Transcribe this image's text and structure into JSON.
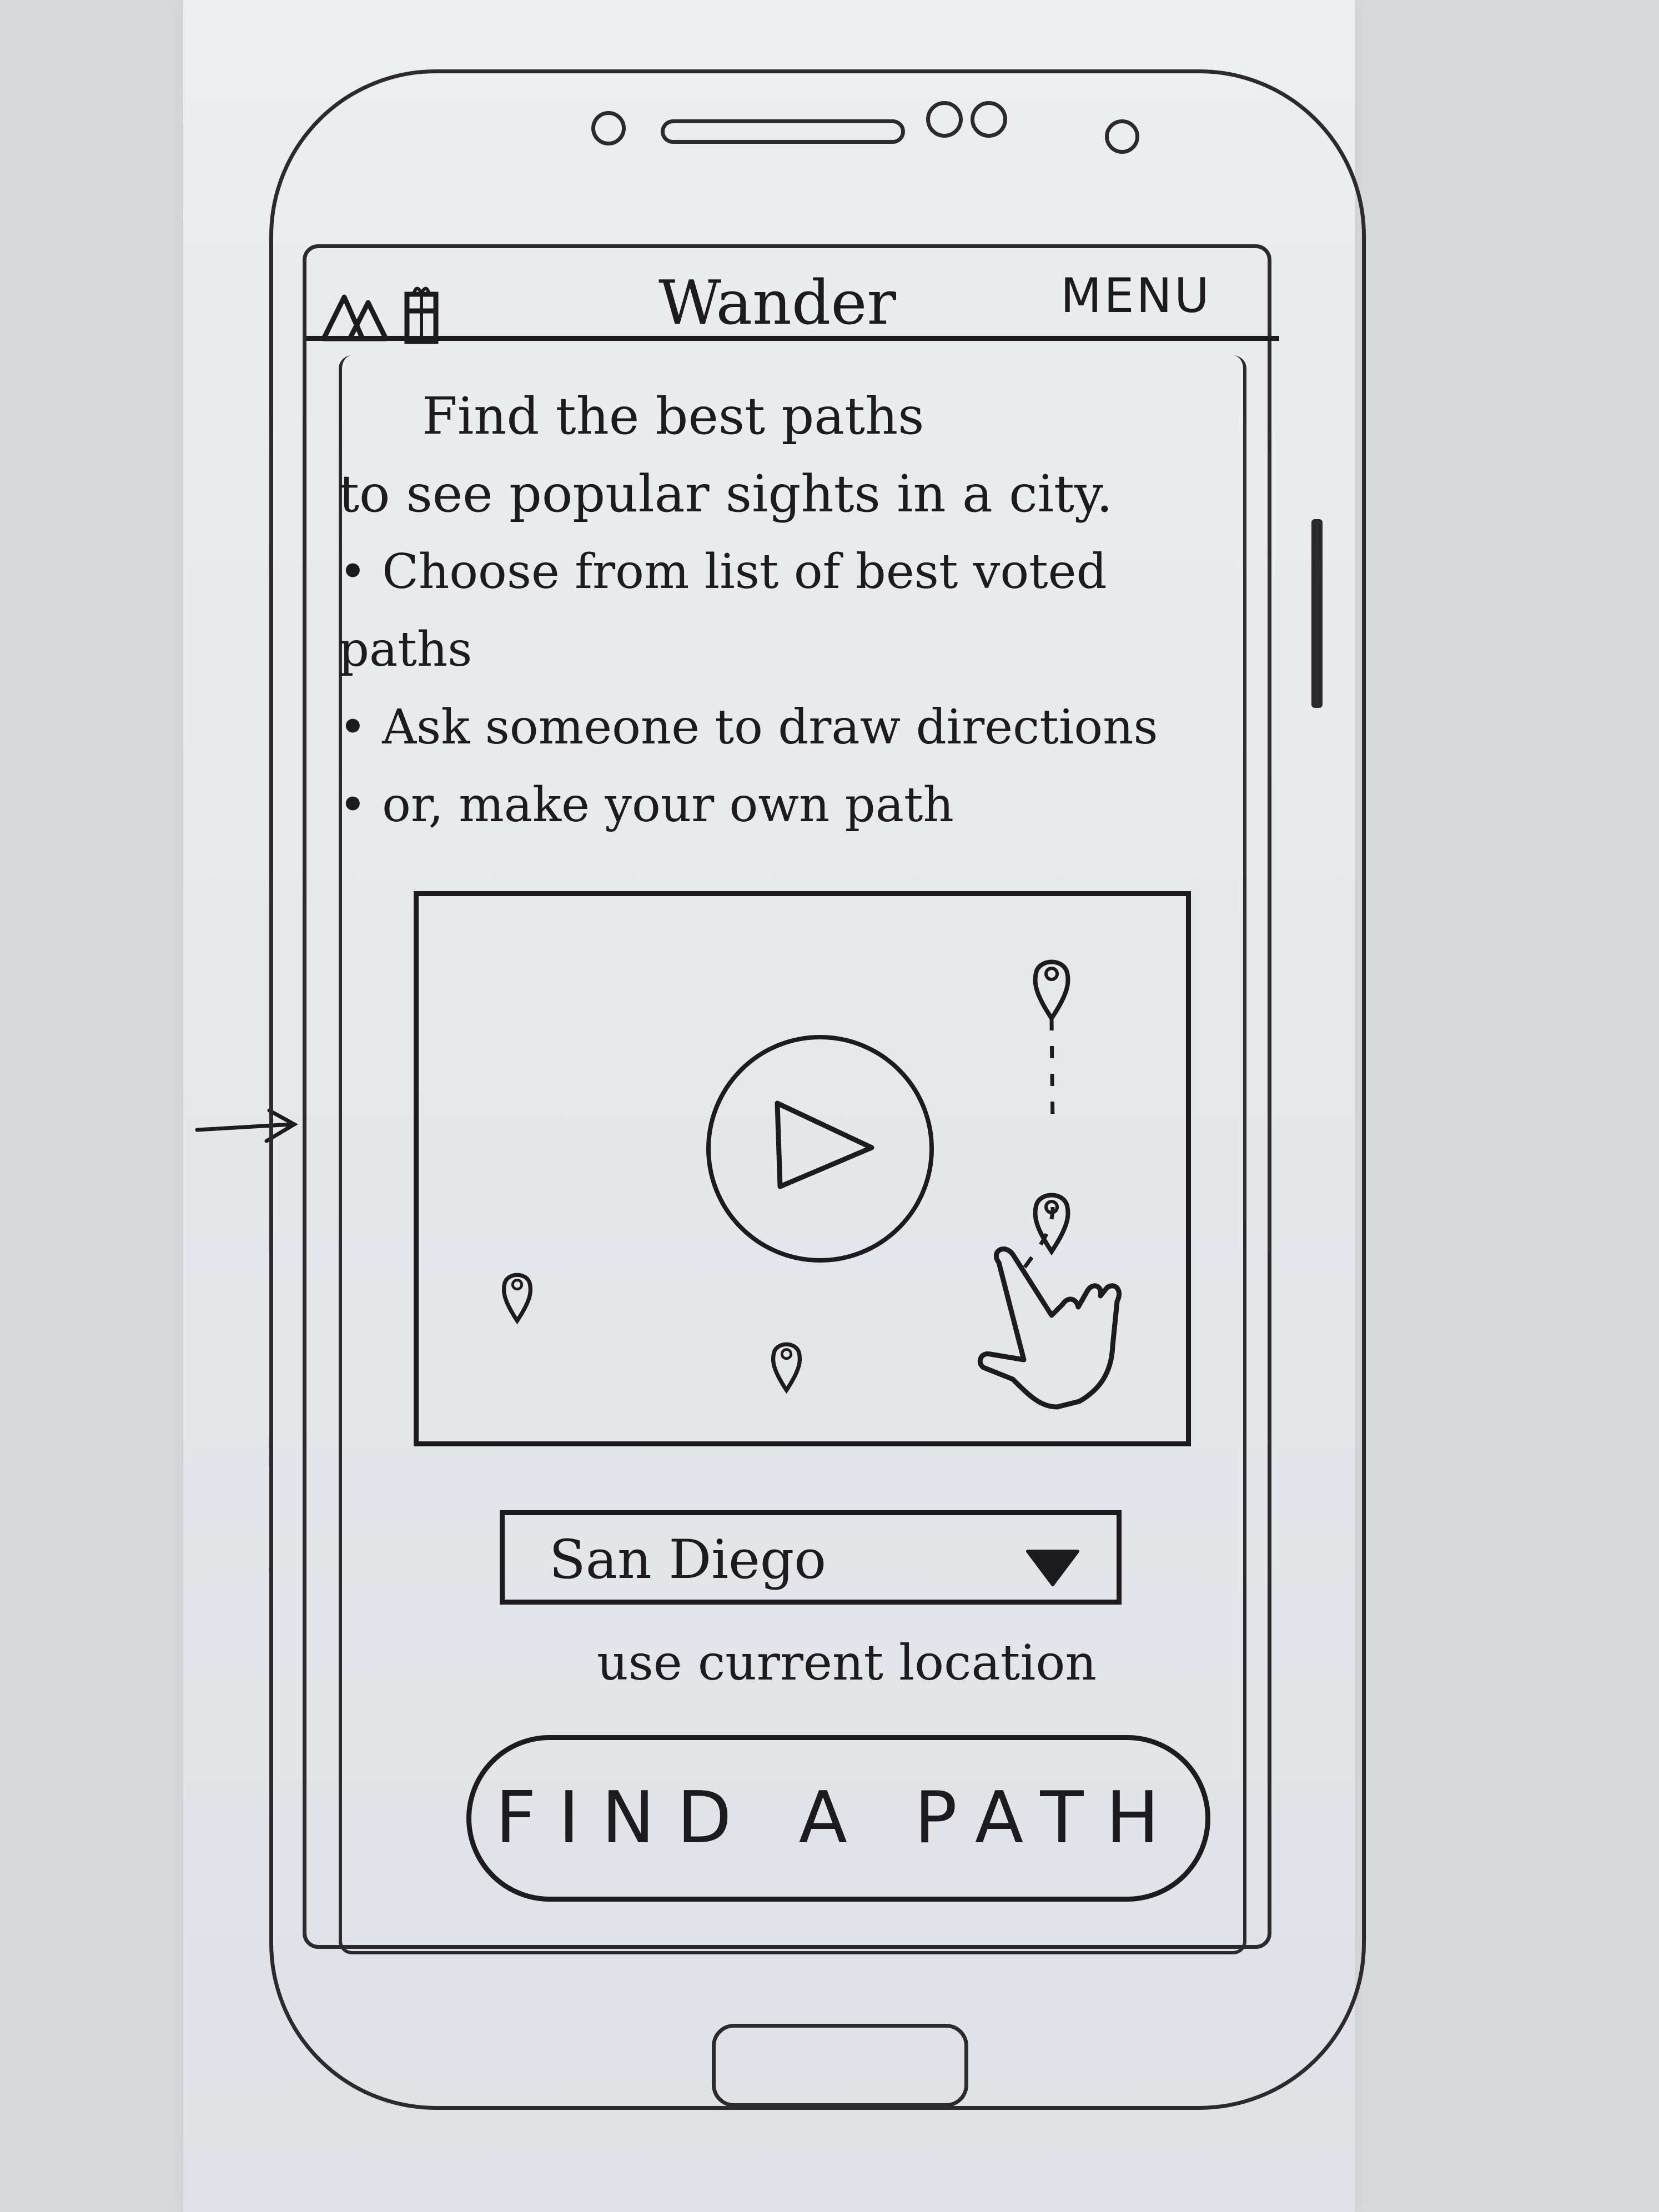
{
  "app": {
    "title": "Wander",
    "menu_label": "MENU",
    "left_icons": [
      "mountain-icon",
      "gift-icon"
    ]
  },
  "intro": {
    "line1": "Find the best paths",
    "line2": "to see popular sights in a city.",
    "bullets": [
      "Choose from list of best voted paths",
      "Ask someone to draw directions",
      "or, make your own path"
    ]
  },
  "map": {
    "play_icon": "play-icon",
    "pin_icon": "map-pin-icon",
    "hand_icon": "pointing-hand-icon"
  },
  "location": {
    "selected_city": "San Diego",
    "dropdown_icon": "chevron-down-icon",
    "current_location_label": "use current location"
  },
  "actions": {
    "find_path_label": "FIND A PATH"
  },
  "colors": {
    "ink": "#1c1c1f",
    "paper": "#e8eaee"
  }
}
